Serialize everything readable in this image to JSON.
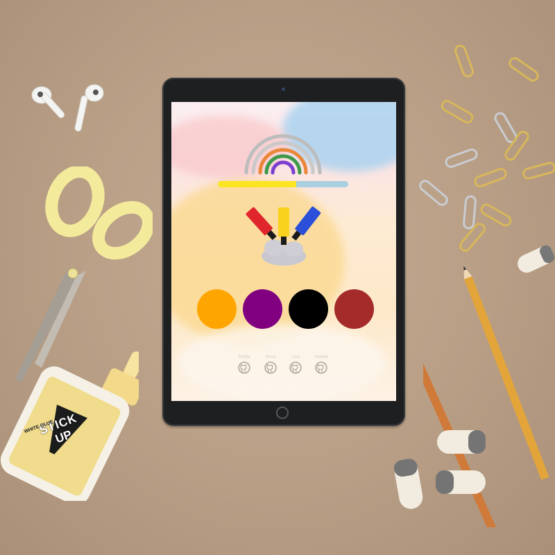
{
  "scene": {
    "description_colors": {
      "desk": "#b99f86",
      "tablet_bezel": "#1e1f21"
    }
  },
  "app": {
    "progress_fraction": 0.6,
    "progress_colors": {
      "fill": "#fbe421",
      "track": "#a9cfe0"
    },
    "paint_tubes": [
      {
        "icon": "red-paint-tube-icon",
        "color": "#e0262c"
      },
      {
        "icon": "yellow-paint-tube-icon",
        "color": "#f8d21c"
      },
      {
        "icon": "blue-paint-tube-icon",
        "color": "#2b4fd8"
      }
    ],
    "color_options": [
      {
        "name": "orange",
        "color": "#ffa500"
      },
      {
        "name": "purple",
        "color": "#800080"
      },
      {
        "name": "black",
        "color": "#000000"
      },
      {
        "name": "brown-red",
        "color": "#a52a2a"
      }
    ],
    "team": [
      {
        "name": "Emilia",
        "icon": "github-icon"
      },
      {
        "name": "Anna",
        "icon": "github-icon"
      },
      {
        "name": "Lina",
        "icon": "github-icon"
      },
      {
        "name": "Andrea",
        "icon": "github-icon"
      }
    ]
  },
  "props": {
    "glue_brand_top": "STICK",
    "glue_brand_bottom": "UP",
    "glue_label": "WHITE GLUE"
  }
}
